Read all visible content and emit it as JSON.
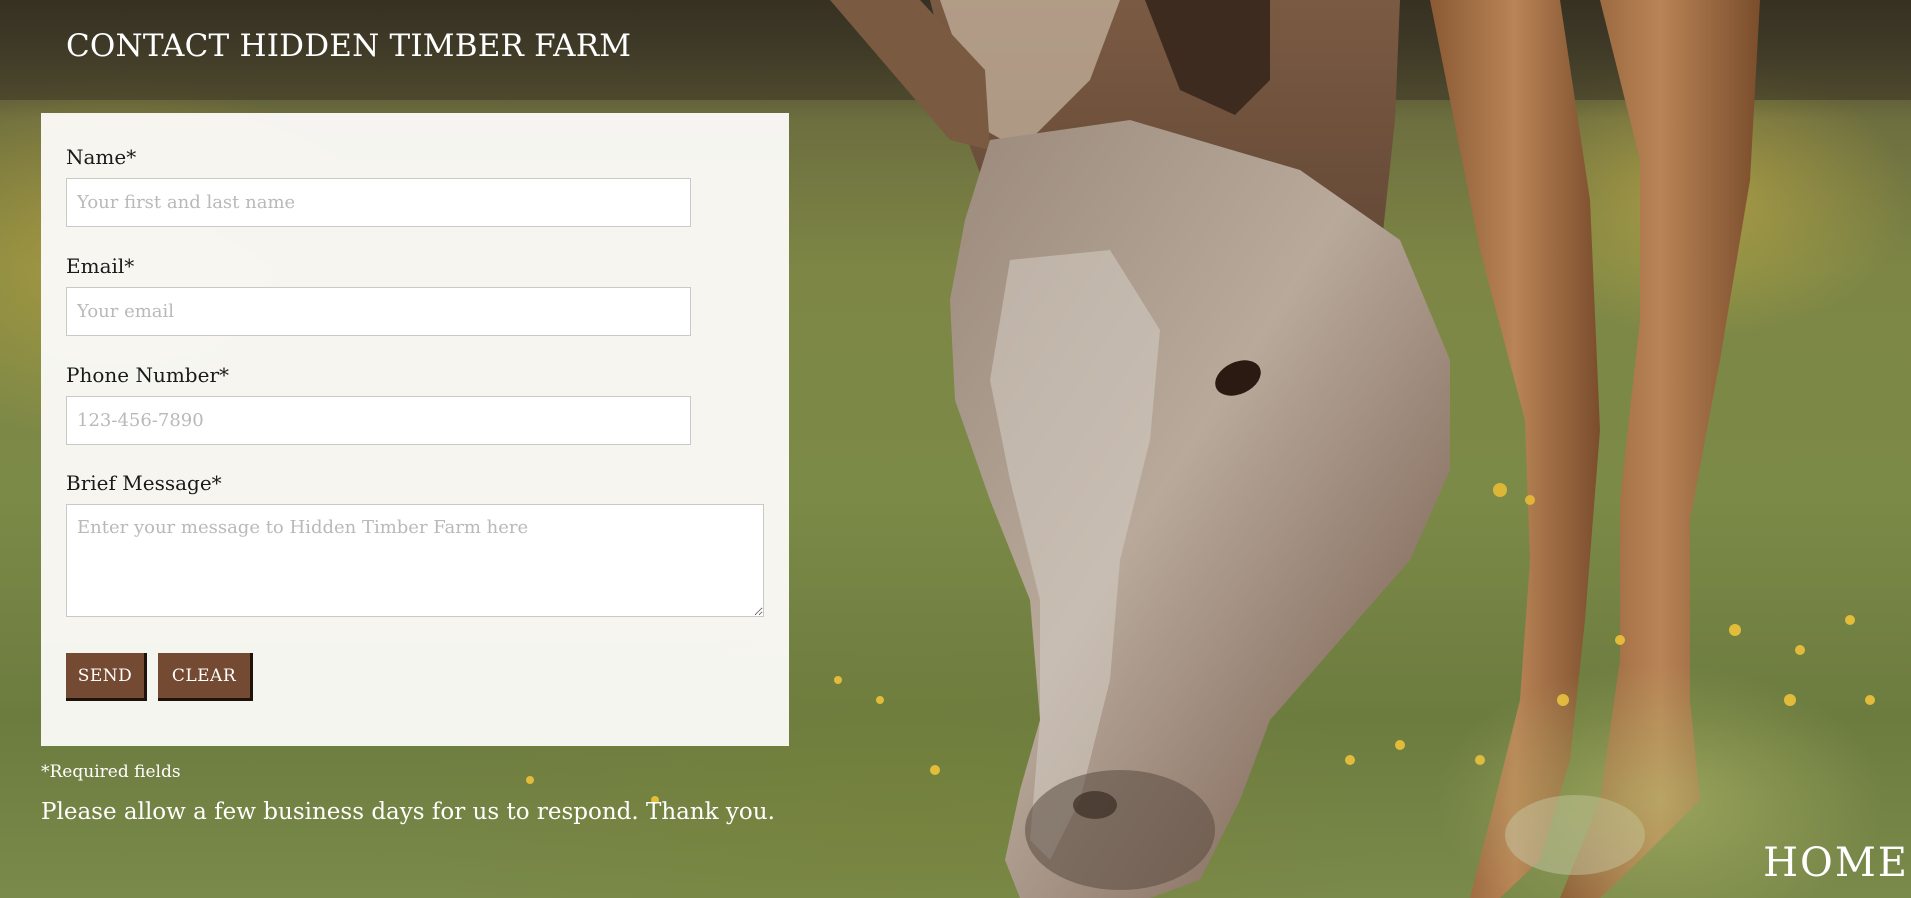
{
  "page": {
    "title": "CONTACT HIDDEN TIMBER FARM"
  },
  "form": {
    "fields": [
      {
        "label": "Name*",
        "placeholder": "Your first and last name",
        "value": ""
      },
      {
        "label": "Email*",
        "placeholder": "Your email",
        "value": ""
      },
      {
        "label": "Phone Number*",
        "placeholder": "123-456-7890",
        "value": ""
      },
      {
        "label": "Brief Message*",
        "placeholder": "Enter your message to Hidden Timber Farm here",
        "value": ""
      }
    ],
    "send_label": "SEND",
    "clear_label": "CLEAR"
  },
  "notes": {
    "required": "*Required fields",
    "respond": "Please allow a few business days for us to respond. Thank you."
  },
  "nav": {
    "home_label": "HOME"
  },
  "colors": {
    "button_bg": "#744a33",
    "panel_bg": "#faf9f6",
    "text_on_image": "#ffffff"
  },
  "background": {
    "subject": "horse grazing in grassy field"
  }
}
